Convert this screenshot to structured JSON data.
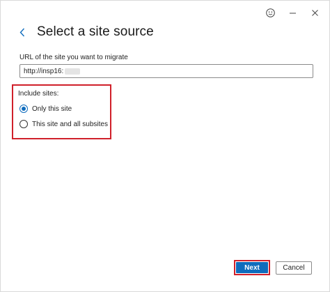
{
  "titlebar": {
    "icons": [
      "smiley-feedback-icon",
      "minimize-icon",
      "close-icon"
    ]
  },
  "header": {
    "title": "Select a site source"
  },
  "url_field": {
    "label": "URL of the site you want to migrate",
    "value": "http://insp16:"
  },
  "include_sites": {
    "label": "Include sites:",
    "options": [
      {
        "label": "Only this site",
        "checked": true
      },
      {
        "label": "This site and all subsites",
        "checked": false
      }
    ]
  },
  "footer": {
    "next_label": "Next",
    "cancel_label": "Cancel"
  },
  "colors": {
    "accent": "#0f6cbd",
    "highlight_border": "#d0202a"
  }
}
